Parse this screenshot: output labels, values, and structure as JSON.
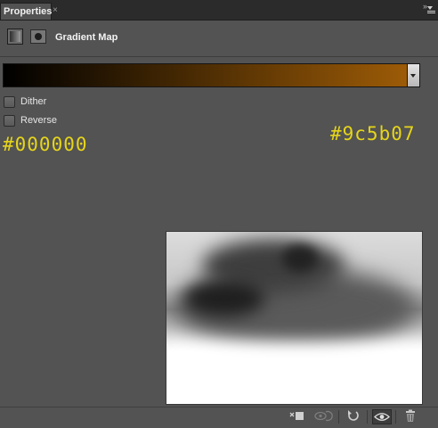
{
  "tabs": {
    "active": "Properties",
    "close_glyph": "×",
    "collapse_glyph": "»"
  },
  "panel": {
    "title": "Gradient Map"
  },
  "gradient": {
    "start_color": "#000000",
    "end_color": "#9c5b07"
  },
  "options": {
    "dither_label": "Dither",
    "reverse_label": "Reverse"
  },
  "annotations": {
    "start_hex": "#000000",
    "end_hex": "#9c5b07"
  },
  "footer": {
    "clip_icon": "clip-to-layer-icon",
    "view_previous_icon": "view-previous-state-icon",
    "reset_icon": "reset-icon",
    "visibility_icon": "eye-icon",
    "delete_icon": "trash-icon"
  }
}
